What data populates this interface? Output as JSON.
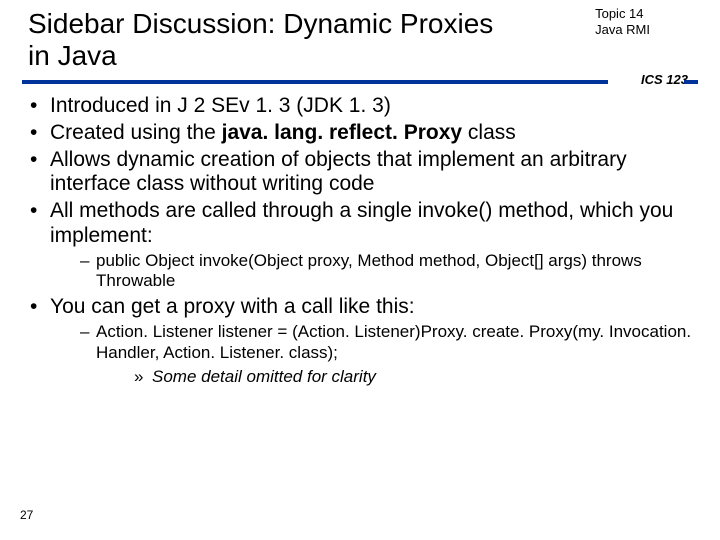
{
  "header": {
    "title": "Sidebar Discussion: Dynamic Proxies in Java",
    "topic_line1": "Topic 14",
    "topic_line2": "Java RMI",
    "course": "ICS 123"
  },
  "bullets": {
    "b1": "Introduced in J 2 SEv 1. 3 (JDK 1. 3)",
    "b2_pre": "Created using the ",
    "b2_bold": "java. lang. reflect. Proxy",
    "b2_post": " class",
    "b3": "Allows dynamic creation of objects that implement an arbitrary interface class without writing code",
    "b4": "All methods are called through a single invoke() method, which you implement:",
    "b4_sub": "public Object invoke(Object proxy, Method method, Object[] args) throws Throwable",
    "b5": "You can get a proxy with a call like this:",
    "b5_sub": "Action. Listener listener = (Action. Listener)Proxy. create. Proxy(my. Invocation. Handler, Action. Listener. class);",
    "b5_sub2": "Some detail omitted for clarity"
  },
  "page_number": "27"
}
